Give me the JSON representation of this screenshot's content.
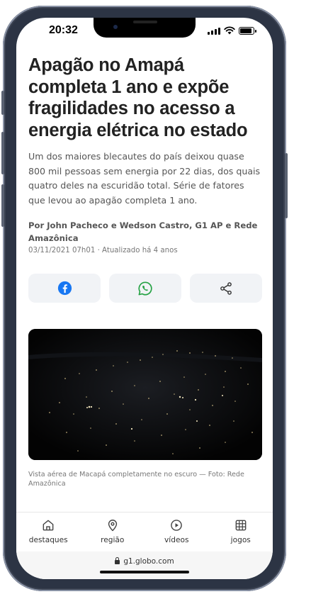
{
  "status_bar": {
    "time": "20:32"
  },
  "article": {
    "headline": "Apagão no Amapá completa 1 ano e expõe fragilidades no acesso a energia elétrica no estado",
    "subtitle": "Um dos maiores blecautes do país deixou quase 800 mil pessoas sem energia por 22 dias, dos quais quatro deles na escuridão total. Série de fatores que levou ao apagão completa 1 ano.",
    "byline": "Por John Pacheco e Wedson Castro, G1 AP e Rede Amazônica",
    "dateline": "03/11/2021 07h01 · Atualizado há 4 anos",
    "photo_caption": "Vista aérea de Macapá completamente no escuro — Foto: Rede Amazônica"
  },
  "share_buttons": [
    {
      "icon": "facebook-icon",
      "color": "#1877f2"
    },
    {
      "icon": "whatsapp-icon",
      "color": "#25a244"
    },
    {
      "icon": "share-icon",
      "color": "#333333"
    }
  ],
  "tab_bar": {
    "tabs": [
      {
        "label": "destaques",
        "icon": "home-icon"
      },
      {
        "label": "região",
        "icon": "location-pin-icon"
      },
      {
        "label": "vídeos",
        "icon": "play-icon"
      },
      {
        "label": "jogos",
        "icon": "grid-icon"
      }
    ]
  },
  "url_bar": {
    "url": "g1.globo.com"
  }
}
